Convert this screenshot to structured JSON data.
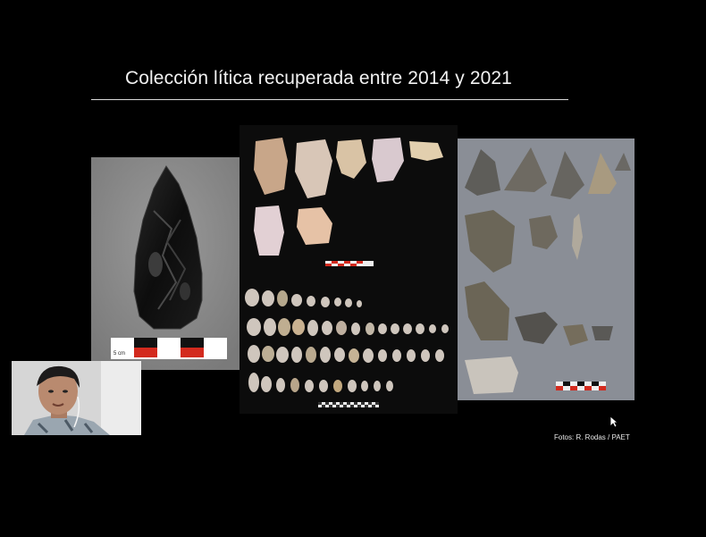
{
  "slide": {
    "title": "Colección lítica recuperada entre 2014 y 2021",
    "credit": "Fotos: R. Rodas / PAET",
    "scale_label": "5 cm"
  },
  "photos": [
    {
      "id": "obsidian-point",
      "subject": "obsidian projectile point"
    },
    {
      "id": "flake-collection",
      "subject": "chert flakes and tools on black background"
    },
    {
      "id": "tool-collection",
      "subject": "stone tools on grey background"
    }
  ],
  "icons": {
    "cursor": "mouse-pointer-icon"
  },
  "colors": {
    "background": "#000000",
    "title_text": "#f2f2f2",
    "rule": "#d9d9d9",
    "scale_red": "#d32a1e"
  }
}
